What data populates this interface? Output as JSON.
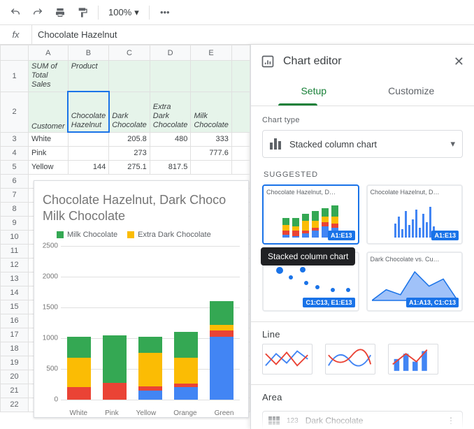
{
  "toolbar": {
    "zoom": "100%"
  },
  "formula_bar": {
    "value": "Chocolate Hazelnut"
  },
  "columns": [
    "A",
    "B",
    "C",
    "D",
    "E"
  ],
  "row_numbers": [
    "1",
    "2",
    "3",
    "4",
    "5",
    "6",
    "7",
    "8",
    "9",
    "10",
    "11",
    "12",
    "13",
    "14",
    "15",
    "16",
    "17",
    "18",
    "19",
    "20",
    "21",
    "22"
  ],
  "pivot": {
    "r1c1": "SUM of Total Sales",
    "r1c2": "Product",
    "r2c1": "Customer",
    "products": [
      "Chocolate Hazelnut",
      "Dark Chocolate",
      "Extra Dark Chocolate",
      "Milk Chocolate"
    ],
    "rows": [
      {
        "cust": "White",
        "vals": [
          "",
          "205.8",
          "480",
          "333"
        ]
      },
      {
        "cust": "Pink",
        "vals": [
          "",
          "273",
          "",
          "777.6"
        ]
      },
      {
        "cust": "Yellow",
        "vals": [
          "144",
          "275.1",
          "817.5",
          ""
        ]
      }
    ]
  },
  "chart_data": {
    "type": "bar",
    "stacked": true,
    "title": "Chocolate Hazelnut, Dark Chocolate, Extra Dark Chocolate and Milk Chocolate",
    "title_visible": "Chocolate Hazelnut, Dark Choco\nMilk Chocolate",
    "categories": [
      "White",
      "Pink",
      "Yellow",
      "Orange",
      "Green"
    ],
    "series": [
      {
        "name": "Chocolate Hazelnut",
        "color": "#4285f4",
        "values": [
          0,
          0,
          144,
          200,
          1020
        ]
      },
      {
        "name": "Dark Chocolate",
        "color": "#ea4335",
        "values": [
          206,
          273,
          75,
          60,
          110
        ]
      },
      {
        "name": "Extra Dark Chocolate",
        "color": "#fbbc04",
        "values": [
          480,
          0,
          545,
          420,
          90
        ]
      },
      {
        "name": "Milk Chocolate",
        "color": "#34a853",
        "values": [
          333,
          778,
          260,
          420,
          380
        ]
      }
    ],
    "ylim": [
      0,
      2500
    ],
    "yticks": [
      0,
      500,
      1000,
      1500,
      2000,
      2500
    ],
    "legend_visible": [
      "Milk Chocolate",
      "Extra Dark Chocolate"
    ]
  },
  "editor": {
    "title": "Chart editor",
    "tabs": {
      "setup": "Setup",
      "customize": "Customize"
    },
    "chart_type_label": "Chart type",
    "chart_type_value": "Stacked column chart",
    "suggested_label": "SUGGESTED",
    "suggested": [
      {
        "title": "Chocolate Hazelnut, D…",
        "badge": "A1:E13",
        "kind": "stacked",
        "selected": true
      },
      {
        "title": "Chocolate Hazelnut, D…",
        "badge": "A1:E13",
        "kind": "columns"
      },
      {
        "title": "",
        "badge": "C1:C13, E1:E13",
        "kind": "scatter"
      },
      {
        "title": "Dark Chocolate vs. Cu…",
        "badge": "A1:A13, C1:C13",
        "kind": "area"
      }
    ],
    "tooltip": "Stacked column chart",
    "line_label": "Line",
    "area_label": "Area",
    "xaxis_field": "Dark Chocolate",
    "xaxis_prefix": "123"
  }
}
